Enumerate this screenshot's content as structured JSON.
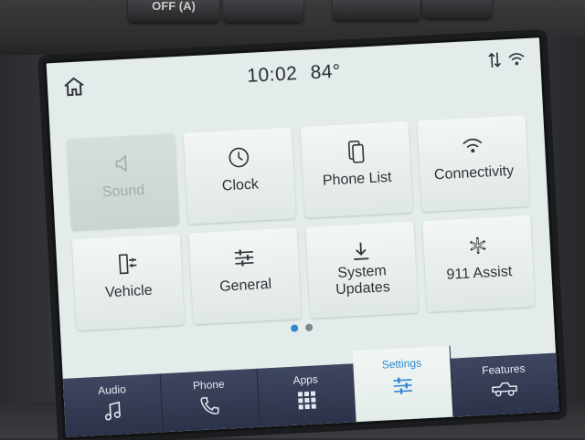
{
  "hardware": {
    "button1_label": "OFF (A)"
  },
  "status": {
    "time": "10:02",
    "temperature": "84°"
  },
  "tiles": [
    {
      "label": "Sound",
      "icon": "speaker-icon",
      "enabled": false
    },
    {
      "label": "Clock",
      "icon": "clock-icon",
      "enabled": true
    },
    {
      "label": "Phone List",
      "icon": "phone-list-icon",
      "enabled": true
    },
    {
      "label": "Connectivity",
      "icon": "wifi-icon",
      "enabled": true
    },
    {
      "label": "Vehicle",
      "icon": "vehicle-icon",
      "enabled": true
    },
    {
      "label": "General",
      "icon": "sliders-icon",
      "enabled": true
    },
    {
      "label_line1": "System",
      "label_line2": "Updates",
      "icon": "download-icon",
      "enabled": true
    },
    {
      "label": "911 Assist",
      "icon": "asterisk-icon",
      "enabled": true
    }
  ],
  "pagination": {
    "current": 1,
    "total": 2
  },
  "nav": [
    {
      "label": "Audio",
      "icon": "music-note-icon"
    },
    {
      "label": "Phone",
      "icon": "phone-icon"
    },
    {
      "label": "Apps",
      "icon": "apps-grid-icon"
    },
    {
      "label": "Settings",
      "icon": "settings-sliders-icon",
      "active": true
    },
    {
      "label": "Features",
      "icon": "truck-icon"
    }
  ],
  "colors": {
    "accent": "#2f86d0",
    "active_underline": "#37c3c9",
    "nav_background": "#2c3249",
    "screen_background": "#e3ecea"
  }
}
